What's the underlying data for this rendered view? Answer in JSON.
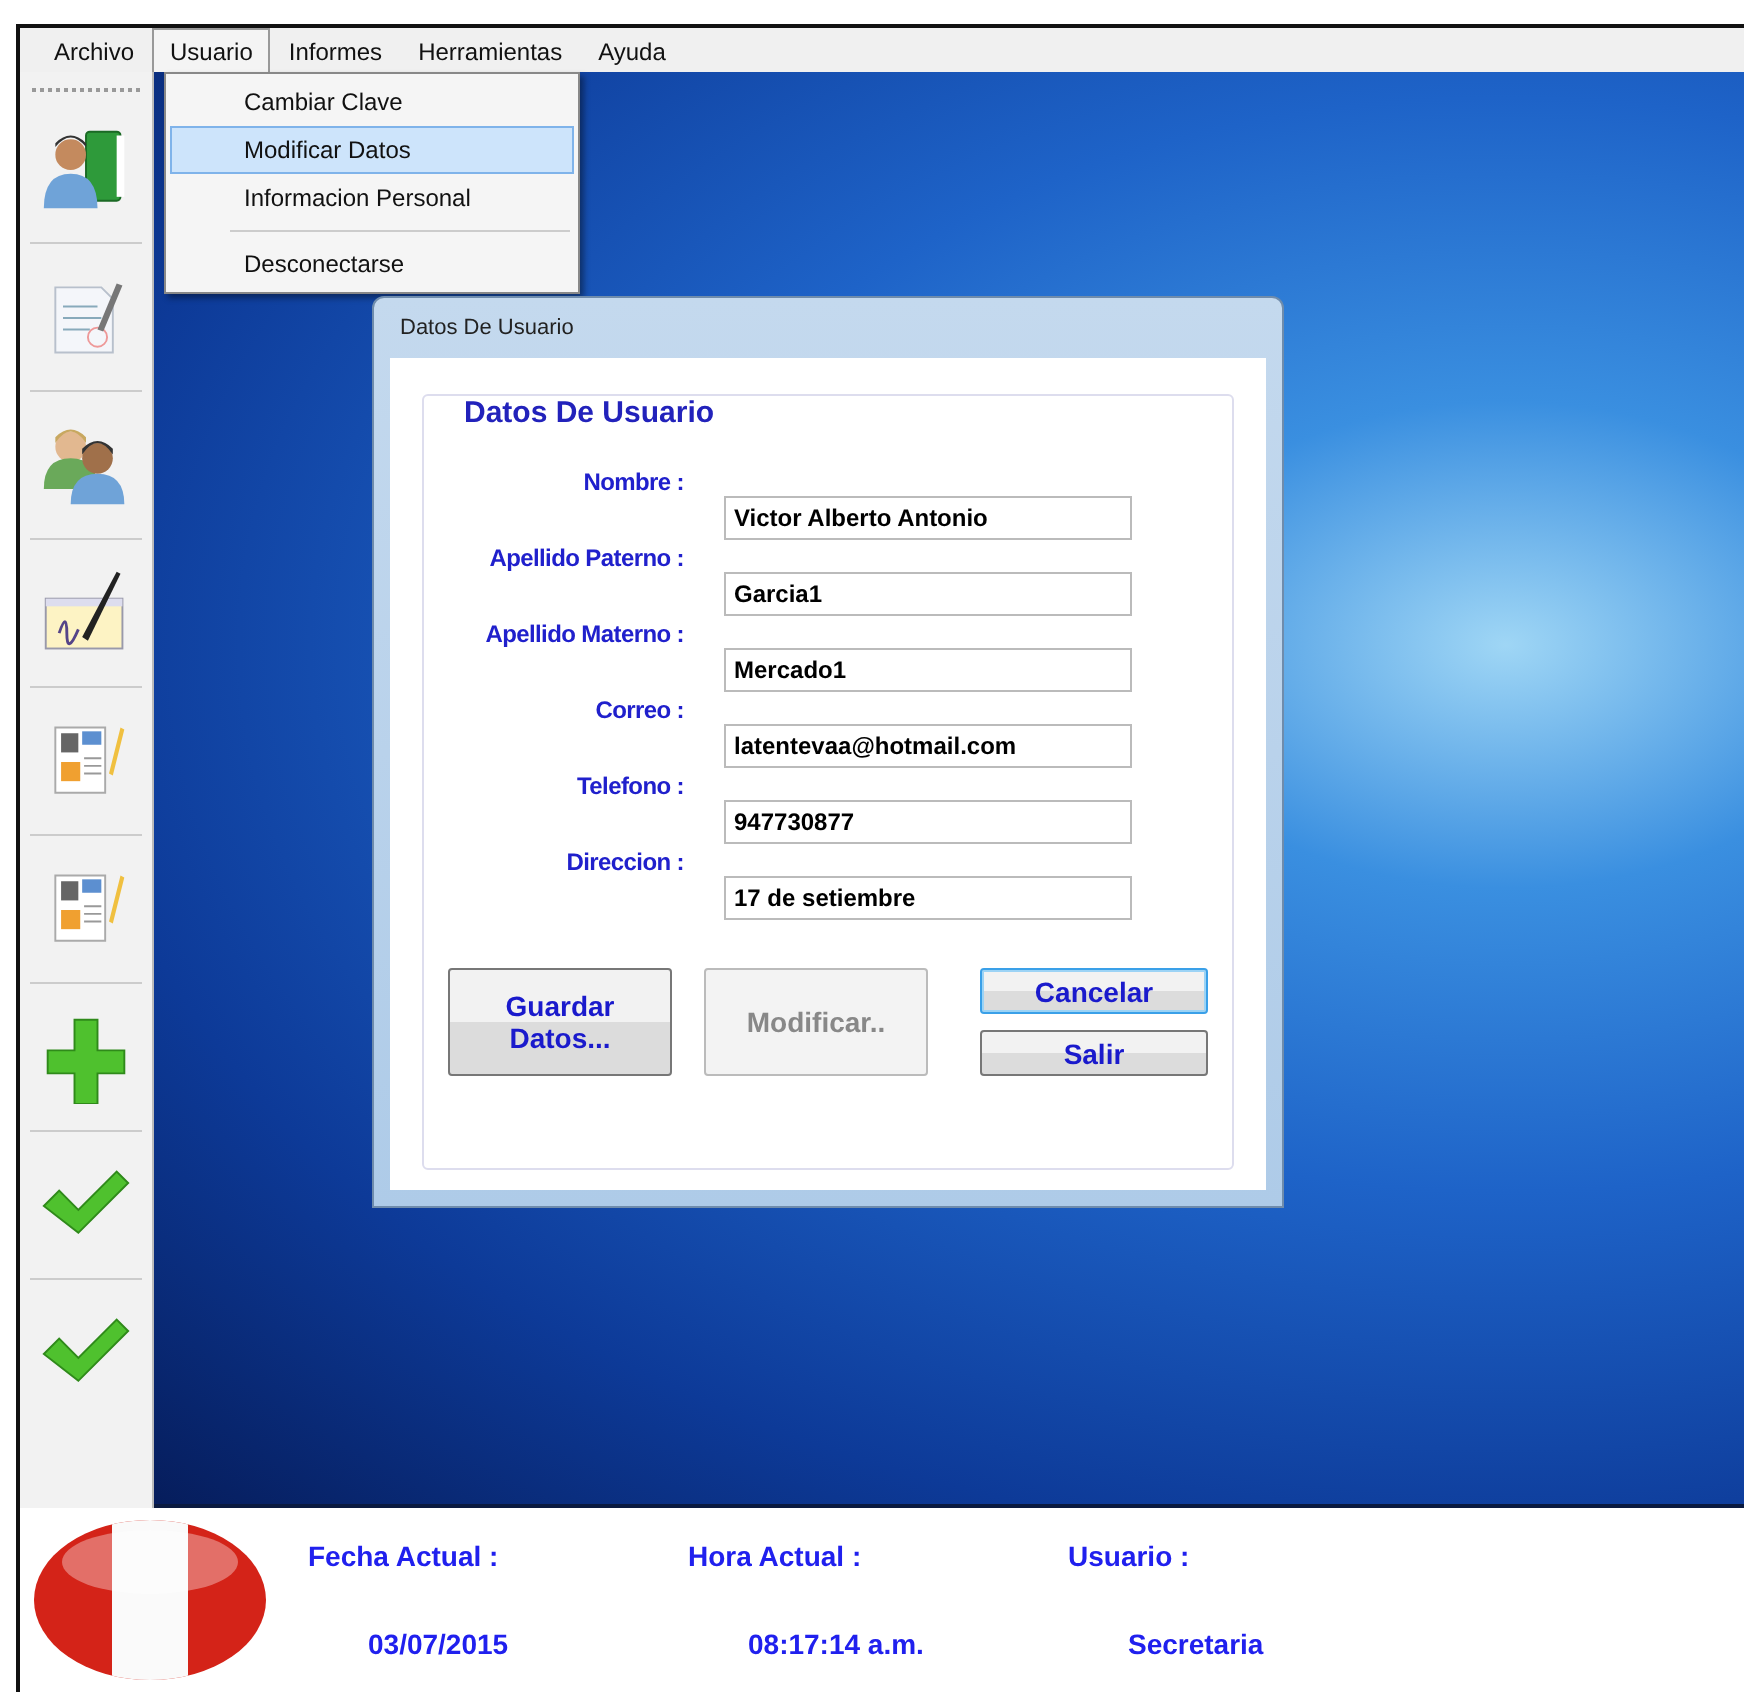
{
  "menu_bar": [
    {
      "label": "Archivo",
      "selected": false
    },
    {
      "label": "Usuario",
      "selected": true
    },
    {
      "label": "Informes",
      "selected": false
    },
    {
      "label": "Herramientas",
      "selected": false
    },
    {
      "label": "Ayuda",
      "selected": false
    }
  ],
  "dropdown_menu": [
    {
      "kind": "item",
      "label": "Cambiar Clave",
      "selected": false
    },
    {
      "kind": "item",
      "label": "Modificar Datos",
      "selected": true
    },
    {
      "kind": "item",
      "label": "Informacion Personal",
      "selected": false
    },
    {
      "kind": "separator"
    },
    {
      "kind": "item",
      "label": "Desconectarse",
      "selected": false
    }
  ],
  "dialog": {
    "title": "Datos De Usuario",
    "group_title": "Datos De Usuario",
    "fields": [
      {
        "label": "Nombre :",
        "value": "Victor Alberto Antonio"
      },
      {
        "label": "Apellido Paterno :",
        "value": "Garcia1"
      },
      {
        "label": "Apellido Materno :",
        "value": "Mercado1"
      },
      {
        "label": "Correo :",
        "value": "latentevaa@hotmail.com"
      },
      {
        "label": "Telefono :",
        "value": "947730877"
      },
      {
        "label": "Direccion :",
        "value": "17 de setiembre"
      }
    ],
    "buttons": [
      {
        "label": "Guardar Datos...",
        "disabled": false,
        "focused": false
      },
      {
        "label": "Modificar..",
        "disabled": true,
        "focused": false
      }
    ],
    "side_buttons": [
      {
        "label": "Cancelar",
        "disabled": false,
        "focused": true
      },
      {
        "label": "Salir",
        "disabled": false,
        "focused": false
      }
    ]
  },
  "status_bar": [
    {
      "label": "Fecha Actual :",
      "value": "03/07/2015"
    },
    {
      "label": "Hora Actual :",
      "value": "08:17:14 a.m."
    },
    {
      "label": "Usuario :",
      "value": "Secretaria"
    }
  ]
}
